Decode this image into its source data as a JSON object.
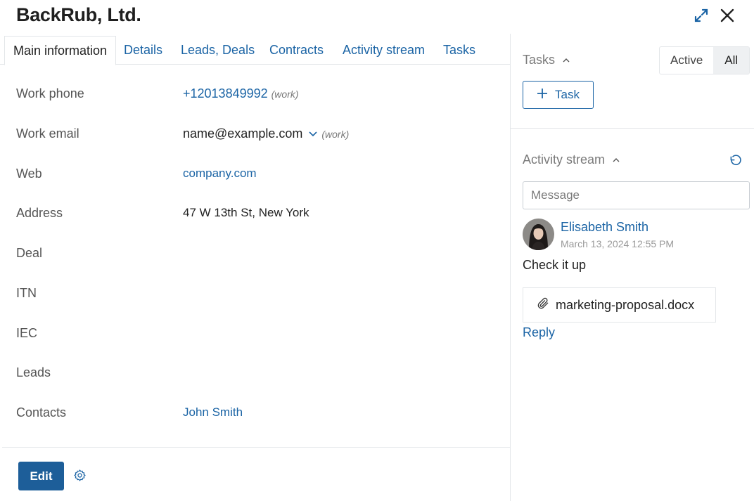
{
  "header": {
    "title": "BackRub, Ltd.",
    "expand_icon": "expand-arrows-icon",
    "close_icon": "close-icon"
  },
  "tabs": [
    {
      "label": "Main information",
      "active": true
    },
    {
      "label": "Details"
    },
    {
      "label": "Leads, Deals"
    },
    {
      "label": "Contracts"
    },
    {
      "label": "Activity stream"
    },
    {
      "label": "Tasks"
    }
  ],
  "fields": {
    "work_phone": {
      "label": "Work phone",
      "value": "+12013849992",
      "tag": "(work)"
    },
    "work_email": {
      "label": "Work email",
      "value": "name@example.com",
      "tag": "(work)"
    },
    "web": {
      "label": "Web",
      "value": "company.com"
    },
    "address": {
      "label": "Address",
      "value": "47 W 13th St, New York"
    },
    "deal": {
      "label": "Deal",
      "value": ""
    },
    "itn": {
      "label": "ITN",
      "value": ""
    },
    "iec": {
      "label": "IEC",
      "value": ""
    },
    "leads": {
      "label": "Leads",
      "value": ""
    },
    "contacts": {
      "label": "Contacts",
      "value": "John Smith"
    }
  },
  "footer": {
    "edit_label": "Edit",
    "settings_icon": "gear-icon"
  },
  "tasks_panel": {
    "title": "Tasks",
    "filter_active": "Active",
    "filter_all": "All",
    "selected_filter": "All",
    "add_task_label": "Task"
  },
  "activity_panel": {
    "title": "Activity stream",
    "message_placeholder": "Message",
    "post": {
      "author": "Elisabeth Smith",
      "date": "March 13, 2024 12:55 PM",
      "text": "Check it up",
      "attachment": "marketing-proposal.docx",
      "reply_label": "Reply"
    }
  },
  "colors": {
    "link": "#1b64a5",
    "primary_button": "#1d5e99",
    "border": "#e3e6e9"
  }
}
